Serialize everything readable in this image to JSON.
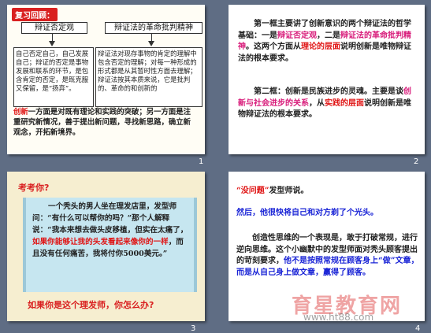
{
  "slides": [
    {
      "number": "1",
      "title": "复习回顾：",
      "left_heading": "辩证否定观",
      "right_heading": "辩证法的革命批判精神",
      "left_body": "自己否定自己，自己发展自己；辩证的否定是事物发展和联系的环节，是包含肯定的否定，是既克服又保留，是“扬弃”。",
      "right_body": "辩证法对现存事物的肯定的理解中包含否定的理解；对每一种形成的形式都是从其暂时性方面去理解；辩证法按其本质来说，它是批判的、革命的和创新的",
      "bottom_red": "创新",
      "bottom_text": "一方面是对既有理论和实践的突破；另一方面是注重研究新情况，善于提出新问题，寻找新思路，确立新观念，开拓新境界。"
    },
    {
      "number": "2",
      "para1_a": "第一框主要讲了创新意识的两个辩证法的哲学基础：一是",
      "para1_b": "辩证否定观",
      "para1_c": "，二是",
      "para1_d": "辩证法的革命批判精神",
      "para1_e": "。这两个方面从",
      "para1_f": "理论的层面",
      "para1_g": "说明创新是唯物辩证法的根本要求。",
      "para2_a": "第二框：创新是民族进步的灵魂。主要是谈",
      "para2_b": "创新与社会进步的关系",
      "para2_c": "，从",
      "para2_d": "实践的层面",
      "para2_e": "说明创新是唯物辩证法的根本要求。"
    },
    {
      "number": "3",
      "title": "考考你?",
      "story_a": "一个秃头的男人坐在理发店里，发型师问：“有什么可以帮你的吗？”那个人解释说：“我本来想去做头皮移植，但实在太痛了，",
      "story_red": "如果你能够让我的头发看起来像你的一样",
      "story_b": "，而且没有任何痛苦，我将付你5000美元。”",
      "question": "如果你是这个理发师，你怎么办?"
    },
    {
      "number": "4",
      "title_red": "“没问题”",
      "title_rest": "发型师说。",
      "line2": "然后，他很快将自己和对方剃了个光头。",
      "para_a": "创造性思维的一个表现是，敢于打破常规，进行逆向思维。这个小幽默中的发型师面对秃头顾客提出的苛刻要求，",
      "para_b": "他不是按照常规在顾客身上“做”文章，而是从自己身上做文章，赢得了顾客。"
    }
  ],
  "watermark": {
    "text": "育星教育网",
    "url": "www.ht88.com"
  }
}
